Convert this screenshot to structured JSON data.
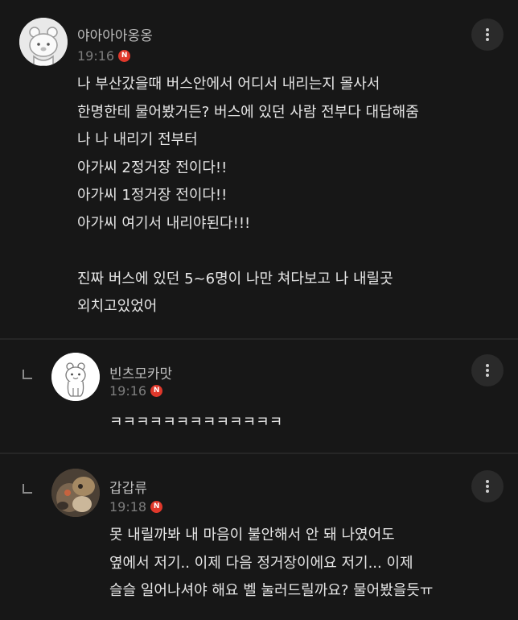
{
  "comments": [
    {
      "username": "야아아아옹옹",
      "time": "19:16",
      "badge": "N",
      "lines": [
        "나 부산갔을때 버스안에서 어디서 내리는지 몰사서",
        "한명한테 물어봤거든? 버스에 있던 사람 전부다 대답해줌",
        "나 나 내리기 전부터",
        "아가씨 2정거장 전이다!!",
        "아가씨 1정거장 전이다!!",
        "아가씨 여기서 내리야된다!!!",
        "",
        "진짜 버스에 있던 5~6명이 나만 쳐다보고 나 내릴곳",
        "외치고있었어"
      ]
    },
    {
      "username": "빈츠모카맛",
      "time": "19:16",
      "badge": "N",
      "lines": [
        "ㅋㅋㅋㅋㅋㅋㅋㅋㅋㅋㅋㅋㅋ"
      ]
    },
    {
      "username": "갑갑류",
      "time": "19:18",
      "badge": "N",
      "lines": [
        "못 내릴까봐 내 마음이 불안해서 안 돼 나였어도",
        "옆에서 저기.. 이제 다음 정거장이에요 저기... 이제",
        "슬슬 일어나셔야 해요 벨 눌러드릴까요? 물어봤을듯ㅠ"
      ]
    }
  ],
  "icons": {
    "more": "more-vertical-icon",
    "reply": "reply-arrow-icon",
    "badge": "new-badge"
  },
  "colors": {
    "background": "#171717",
    "badge": "#e0382b",
    "text": "#e6e6e6",
    "meta": "#7d7d7d"
  }
}
